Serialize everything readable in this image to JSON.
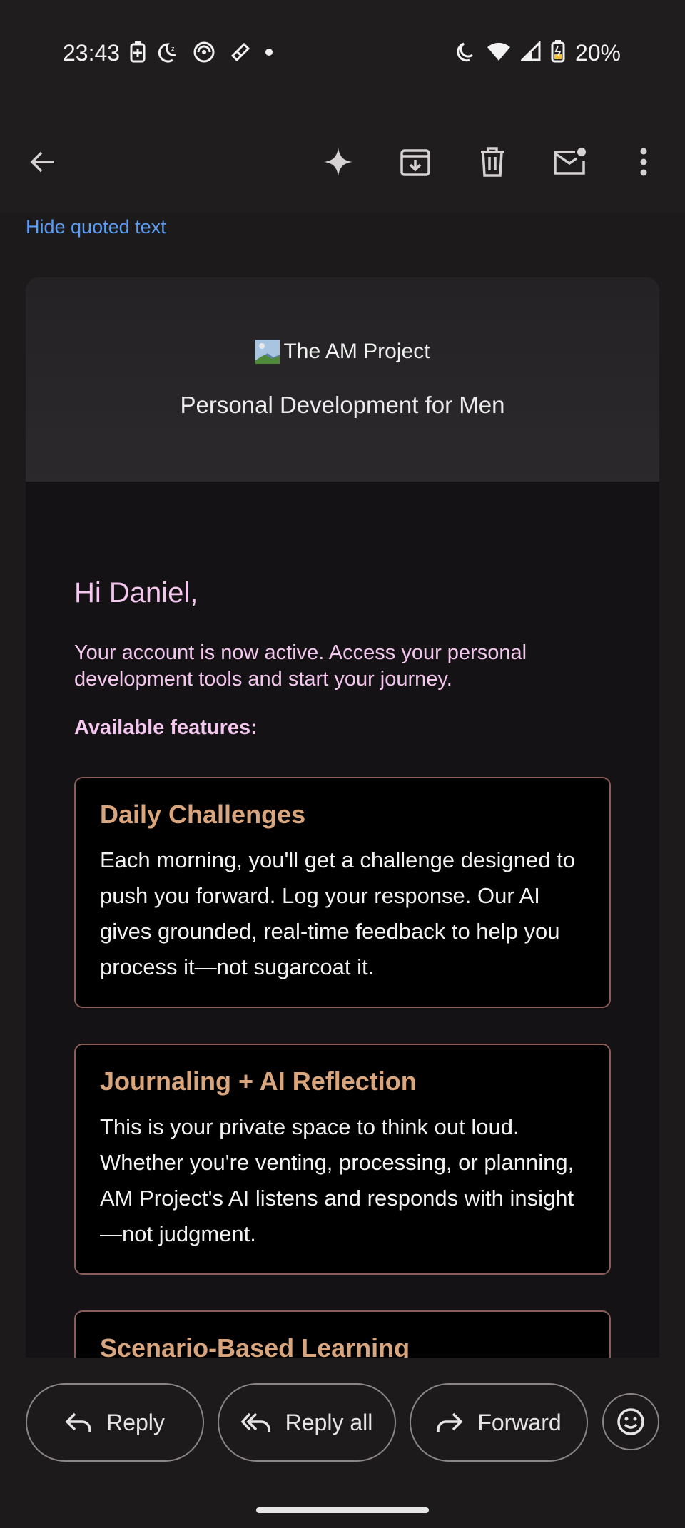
{
  "status": {
    "time": "23:43",
    "battery": "20%"
  },
  "toolbar": {
    "back": "Back",
    "gemini": "Summarize",
    "archive": "Archive",
    "delete": "Delete",
    "mark_unread": "Mark unread",
    "more": "More options"
  },
  "thread": {
    "hide_quoted": "Hide quoted text"
  },
  "email": {
    "logo_alt": "The AM Project",
    "tagline": "Personal Development for Men",
    "greeting": "Hi Daniel,",
    "intro": "Your account is now active. Access your personal development tools and start your journey.",
    "features_label": "Available features:",
    "features": [
      {
        "title": "Daily Challenges",
        "text": "Each morning, you'll get a challenge designed to push you forward. Log your response. Our AI gives grounded, real-time feedback to help you process it—not sugarcoat it."
      },
      {
        "title": "Journaling + AI Reflection",
        "text": "This is your private space to think out loud. Whether you're venting, processing, or planning, AM Project's AI listens and responds with insight—not judgment."
      },
      {
        "title": "Scenario-Based Learning",
        "text": ""
      }
    ]
  },
  "actions": {
    "reply": "Reply",
    "reply_all": "Reply all",
    "forward": "Forward"
  },
  "colors": {
    "link": "#5b9cf5",
    "greeting_pink": "#f3c7ee",
    "feature_title": "#d9a57c",
    "feature_border": "#8a5d58"
  }
}
